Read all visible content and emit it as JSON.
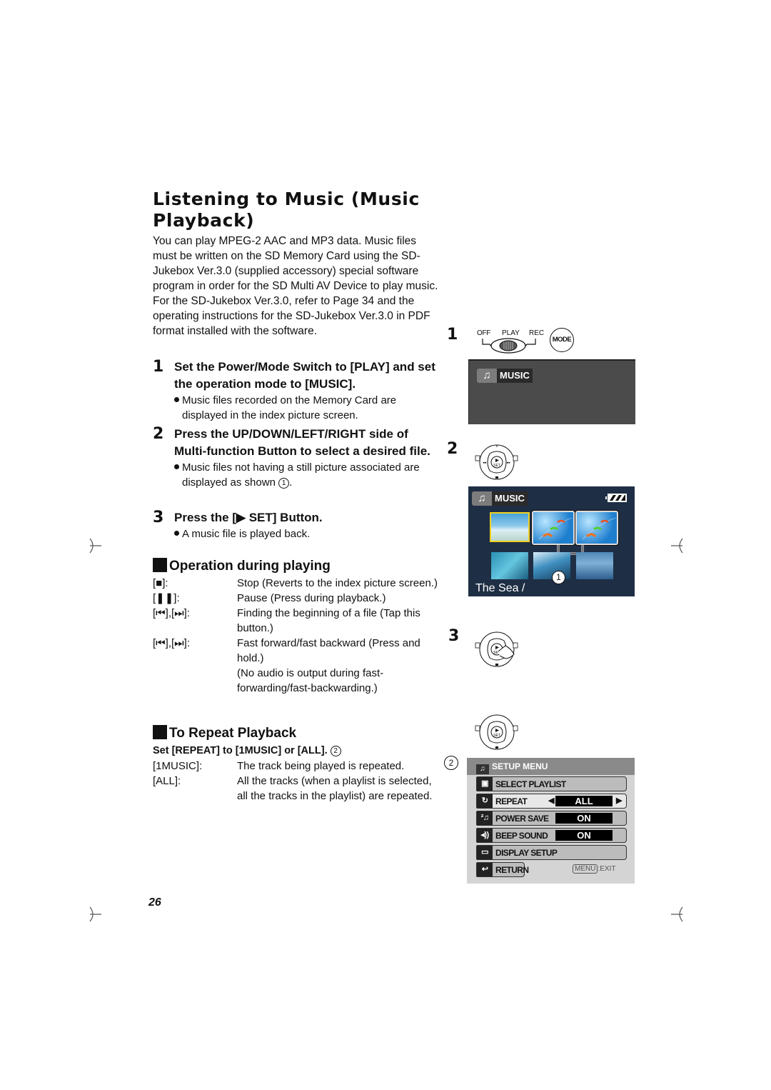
{
  "page": {
    "title": "Listening to Music (Music Playback)",
    "intro": "You can play MPEG-2 AAC and MP3 data. Music files must be written on the SD Memory Card using the SD-Jukebox Ver.3.0 (supplied accessory) special software program in order for the SD Multi AV Device to play music. For the SD-Jukebox Ver.3.0, refer to Page 34 and the operating instructions for the SD-Jukebox Ver.3.0 in PDF format installed with the software.",
    "page_number": "26"
  },
  "steps": [
    {
      "num": "1",
      "heading": "Set the Power/Mode Switch to [PLAY] and set the operation mode to [MUSIC].",
      "bullet": "Music files recorded on the Memory Card are displayed in the index picture screen."
    },
    {
      "num": "2",
      "heading": "Press the UP/DOWN/LEFT/RIGHT side of Multi-function Button to select a desired file.",
      "bullet": "Music files not having a still picture associated are displayed as shown",
      "bullet_ref": "1",
      "bullet_end": "."
    },
    {
      "num": "3",
      "heading": "Press the [▶ SET] Button.",
      "bullet": "A music file is played back."
    }
  ],
  "operation": {
    "heading": "Operation during playing",
    "items": [
      {
        "key": "[■]:",
        "value": "Stop (Reverts to the index picture screen.)"
      },
      {
        "key": "[❚❚]:",
        "value": "Pause (Press during playback.)"
      },
      {
        "key": "[⏮],[⏭]:",
        "value": "Finding the beginning of a file (Tap this button.)"
      },
      {
        "key": "[⏮],[⏭]:",
        "value": "Fast forward/fast backward (Press and hold.)"
      },
      {
        "key": "",
        "value": "(No audio is output during fast-forwarding/fast-backwarding.)"
      }
    ]
  },
  "repeat": {
    "heading": "To Repeat Playback",
    "subheading": "Set [REPEAT] to [1MUSIC] or [ALL].",
    "subheading_ref": "2",
    "items": [
      {
        "key": "[1MUSIC]:",
        "value": "The track being played is repeated."
      },
      {
        "key": "[ALL]:",
        "value": "All the tracks (when a playlist is selected, all the tracks in the playlist) are repeated."
      }
    ]
  },
  "figures": {
    "fig1": {
      "num": "1",
      "switch_labels": [
        "OFF",
        "PLAY",
        "REC"
      ],
      "mode_button": "MODE",
      "screen_label": "MUSIC"
    },
    "fig2": {
      "num": "2",
      "screen_label": "MUSIC",
      "ref": "1",
      "file_title": "The Sea /",
      "dial_set": "SET"
    },
    "fig3": {
      "num": "3",
      "dial_set": "SET"
    },
    "fig_setup": {
      "ref": "2",
      "dial_set": "SET",
      "menu_title": "SETUP MENU",
      "rows": [
        {
          "label": "SELECT PLAYLIST",
          "value": ""
        },
        {
          "label": "REPEAT",
          "value": "ALL"
        },
        {
          "label": "POWER SAVE",
          "value": "ON"
        },
        {
          "label": "BEEP SOUND",
          "value": "ON"
        },
        {
          "label": "DISPLAY SETUP",
          "value": ""
        }
      ],
      "return_label": "RETURN",
      "menu_key": "MENU",
      "exit_label": ":EXIT"
    }
  },
  "colors": {
    "screen_dark": "#4b4b4b",
    "index_bg": "#1e2e44",
    "selected_frame": "#f0d020",
    "menu_bg": "#d4d4d4"
  }
}
